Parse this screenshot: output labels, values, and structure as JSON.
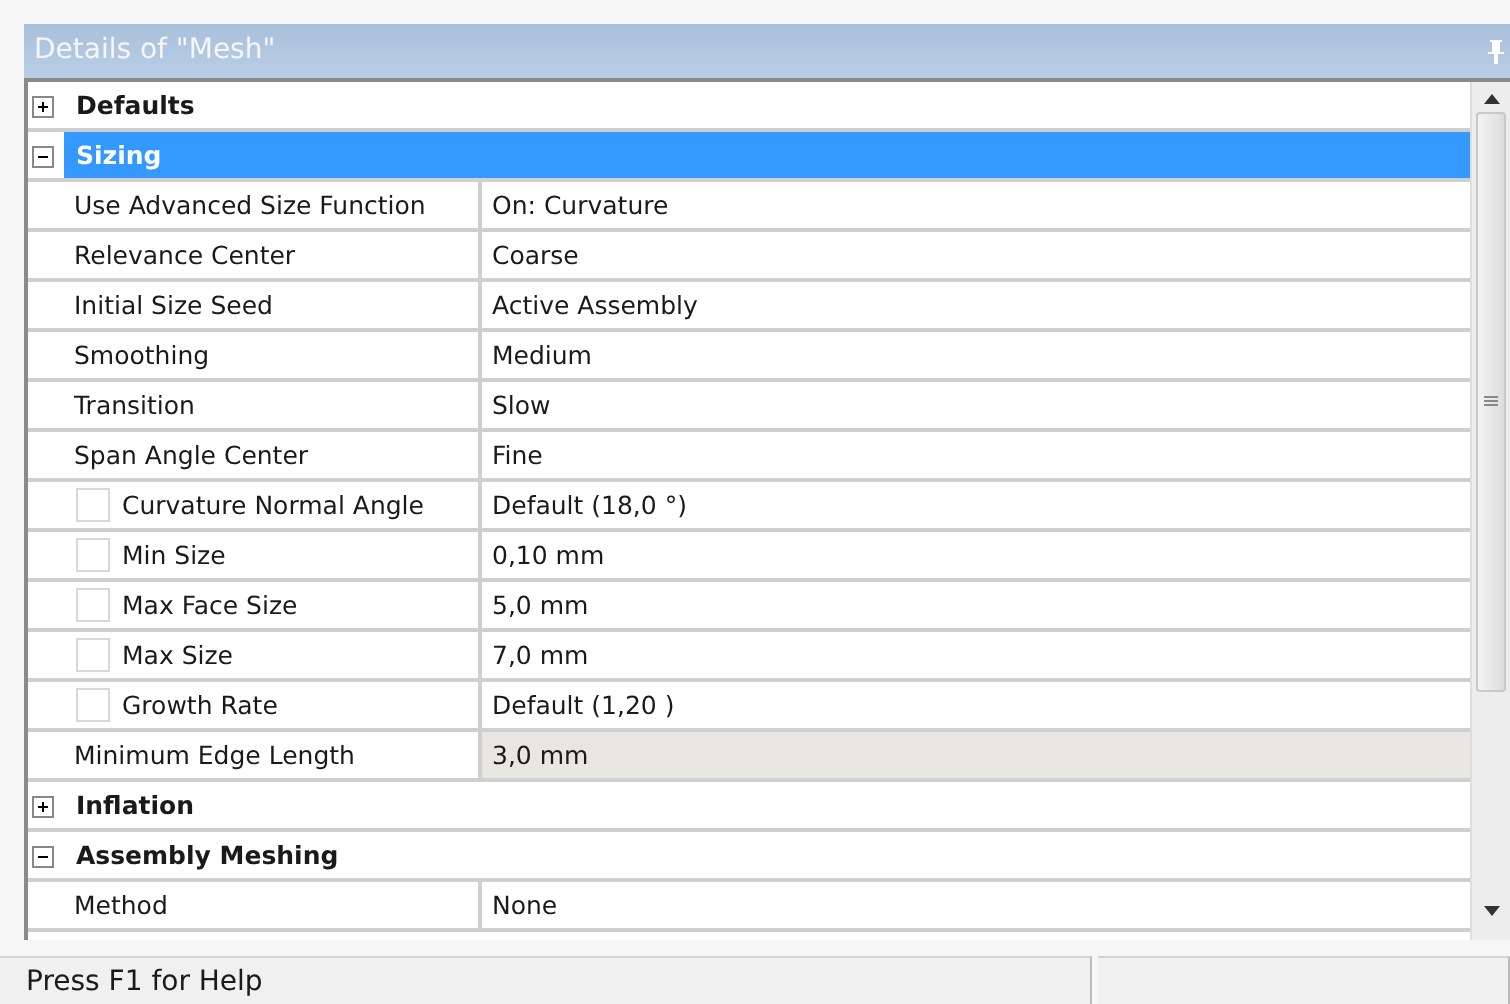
{
  "panel": {
    "title": "Details of \"Mesh\""
  },
  "sections": [
    {
      "label": "Defaults",
      "expanded": false,
      "selected": false
    },
    {
      "label": "Sizing",
      "expanded": true,
      "selected": true,
      "rows": [
        {
          "label": "Use Advanced Size Function",
          "value": "On: Curvature",
          "kind": "plain",
          "readonly": false
        },
        {
          "label": "Relevance Center",
          "value": "Coarse",
          "kind": "plain",
          "readonly": false
        },
        {
          "label": "Initial Size Seed",
          "value": "Active Assembly",
          "kind": "plain",
          "readonly": false
        },
        {
          "label": "Smoothing",
          "value": "Medium",
          "kind": "plain",
          "readonly": false
        },
        {
          "label": "Transition",
          "value": "Slow",
          "kind": "plain",
          "readonly": false
        },
        {
          "label": "Span Angle Center",
          "value": "Fine",
          "kind": "plain",
          "readonly": false
        },
        {
          "label": "Curvature Normal Angle",
          "value": "Default (18,0 °)",
          "kind": "checkbox",
          "checked": false,
          "readonly": false
        },
        {
          "label": "Min Size",
          "value": "0,10 mm",
          "kind": "checkbox",
          "checked": false,
          "readonly": false
        },
        {
          "label": "Max Face Size",
          "value": "5,0 mm",
          "kind": "checkbox",
          "checked": false,
          "readonly": false
        },
        {
          "label": "Max Size",
          "value": "7,0 mm",
          "kind": "checkbox",
          "checked": false,
          "readonly": false
        },
        {
          "label": "Growth Rate",
          "value": "Default (1,20 )",
          "kind": "checkbox",
          "checked": false,
          "readonly": false
        },
        {
          "label": "Minimum Edge Length",
          "value": "3,0 mm",
          "kind": "plain",
          "readonly": true
        }
      ]
    },
    {
      "label": "Inflation",
      "expanded": false,
      "selected": false
    },
    {
      "label": "Assembly Meshing",
      "expanded": true,
      "selected": false,
      "rows": [
        {
          "label": "Method",
          "value": "None",
          "kind": "plain",
          "readonly": false
        }
      ]
    }
  ],
  "status_bar": {
    "text": "Press F1 for Help"
  }
}
